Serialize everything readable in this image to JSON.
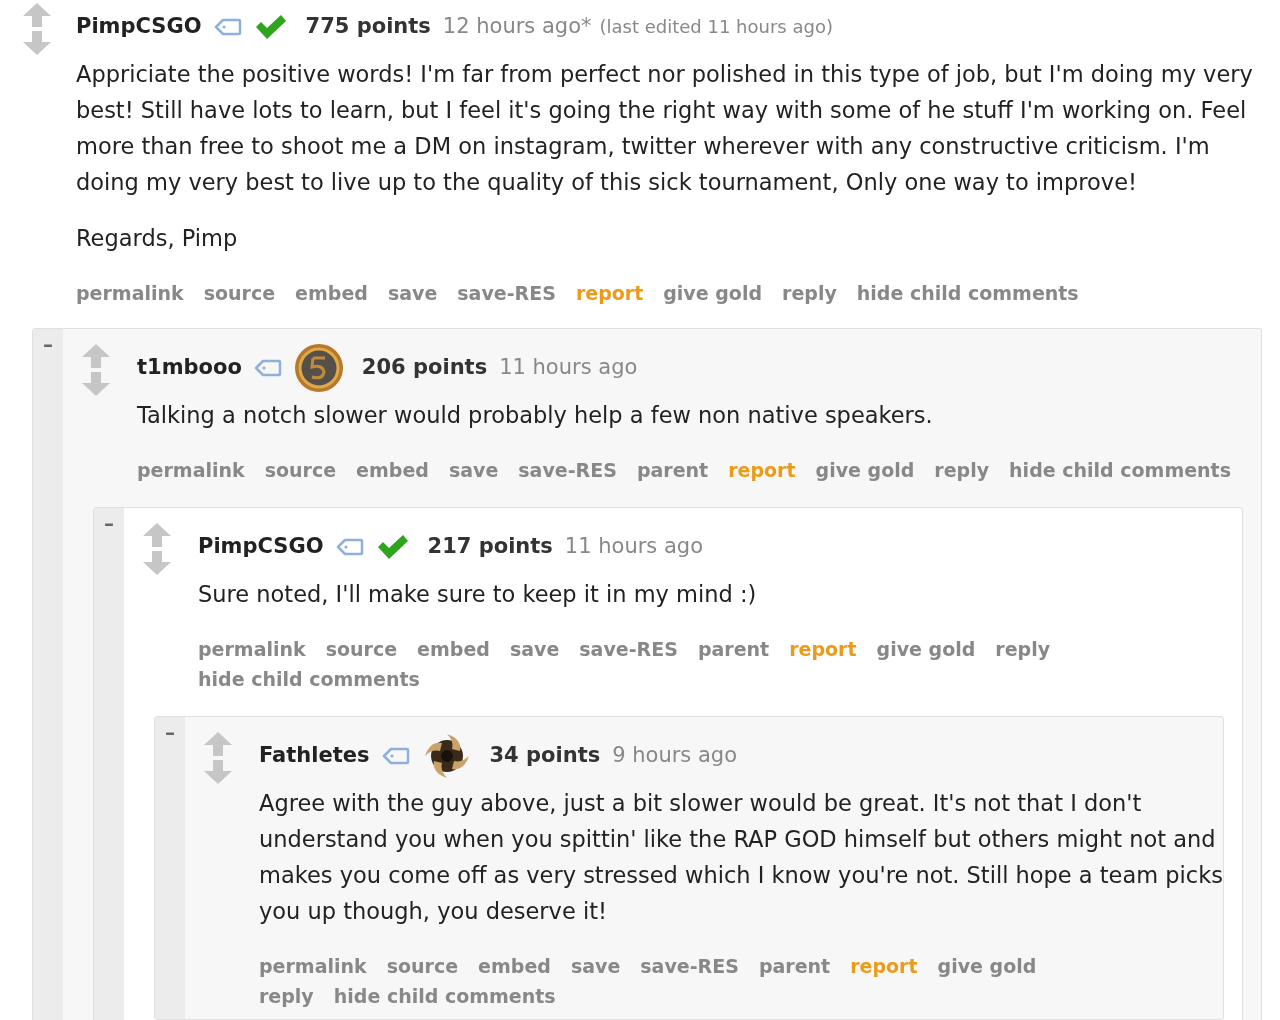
{
  "comment": {
    "author": "PimpCSGO",
    "flair": {
      "kind": "check"
    },
    "score": "775 points",
    "time": "12 hours ago*",
    "edited": "(last edited 11 hours ago)",
    "body": [
      "Appriciate the positive words! I'm far from perfect nor polished in this type of job, but I'm doing my very best! Still have lots to learn, but I feel it's going the right way with some of he stuff I'm working on. Feel more than free to shoot me a DM on instagram, twitter wherever with any constructive criticism. I'm doing my very best to live up to the quality of this sick tournament, Only one way to improve!",
      "Regards, Pimp"
    ],
    "actions": [
      {
        "label": "permalink",
        "kind": "normal"
      },
      {
        "label": "source",
        "kind": "normal"
      },
      {
        "label": "embed",
        "kind": "normal"
      },
      {
        "label": "save",
        "kind": "normal"
      },
      {
        "label": "save-RES",
        "kind": "normal"
      },
      {
        "label": "report",
        "kind": "report"
      },
      {
        "label": "give gold",
        "kind": "normal"
      },
      {
        "label": "reply",
        "kind": "normal"
      },
      {
        "label": "hide child comments",
        "kind": "normal"
      }
    ],
    "children": [
      {
        "collapse": "–",
        "author": "t1mbooo",
        "flair": {
          "kind": "coin"
        },
        "score": "206 points",
        "time": "11 hours ago",
        "body": [
          "Talking a notch slower would probably help a few non native speakers."
        ],
        "actions": [
          {
            "label": "permalink",
            "kind": "normal"
          },
          {
            "label": "source",
            "kind": "normal"
          },
          {
            "label": "embed",
            "kind": "normal"
          },
          {
            "label": "save",
            "kind": "normal"
          },
          {
            "label": "save-RES",
            "kind": "normal"
          },
          {
            "label": "parent",
            "kind": "normal"
          },
          {
            "label": "report",
            "kind": "report"
          },
          {
            "label": "give gold",
            "kind": "normal"
          },
          {
            "label": "reply",
            "kind": "normal"
          },
          {
            "label": "hide child comments",
            "kind": "normal"
          }
        ],
        "children": [
          {
            "collapse": "–",
            "author": "PimpCSGO",
            "flair": {
              "kind": "check"
            },
            "score": "217 points",
            "time": "11 hours ago",
            "body": [
              "Sure noted, I'll make sure to keep it in my mind :)"
            ],
            "actions": [
              {
                "label": "permalink",
                "kind": "normal"
              },
              {
                "label": "source",
                "kind": "normal"
              },
              {
                "label": "embed",
                "kind": "normal"
              },
              {
                "label": "save",
                "kind": "normal"
              },
              {
                "label": "save-RES",
                "kind": "normal"
              },
              {
                "label": "parent",
                "kind": "normal"
              },
              {
                "label": "report",
                "kind": "report"
              },
              {
                "label": "give gold",
                "kind": "normal"
              },
              {
                "label": "reply",
                "kind": "normal"
              },
              {
                "label": "hide child comments",
                "kind": "normal"
              }
            ],
            "children": [
              {
                "collapse": "–",
                "author": "Fathletes",
                "flair": {
                  "kind": "swirl"
                },
                "score": "34 points",
                "time": "9 hours ago",
                "body": [
                  "Agree with the guy above, just a bit slower would be great. It's not that I don't understand you when you spittin' like the RAP GOD himself but others might not and makes you come off as very stressed which I know you're not. Still hope a team picks you up though, you deserve it!"
                ],
                "actions": [
                  {
                    "label": "permalink",
                    "kind": "normal"
                  },
                  {
                    "label": "source",
                    "kind": "normal"
                  },
                  {
                    "label": "embed",
                    "kind": "normal"
                  },
                  {
                    "label": "save",
                    "kind": "normal"
                  },
                  {
                    "label": "save-RES",
                    "kind": "normal"
                  },
                  {
                    "label": "parent",
                    "kind": "normal"
                  },
                  {
                    "label": "report",
                    "kind": "report"
                  },
                  {
                    "label": "give gold",
                    "kind": "normal"
                  },
                  {
                    "label": "reply",
                    "kind": "normal"
                  },
                  {
                    "label": "hide child comments",
                    "kind": "normal"
                  }
                ]
              }
            ]
          }
        ]
      }
    ]
  }
}
